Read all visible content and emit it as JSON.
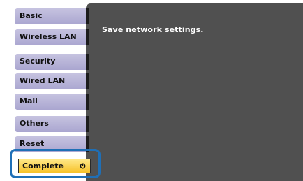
{
  "menu": {
    "items": [
      {
        "label": "Basic"
      },
      {
        "label": "Wireless LAN"
      },
      {
        "label": "Security"
      },
      {
        "label": "Wired LAN"
      },
      {
        "label": "Mail"
      },
      {
        "label": "Others"
      },
      {
        "label": "Reset"
      }
    ],
    "selected": {
      "label": "Complete",
      "icon": "enter-icon"
    }
  },
  "panel": {
    "message": "Save network settings."
  },
  "colors": {
    "tab": "#b5b1d8",
    "selected_tab": "#f9cd3c",
    "panel": "#505050",
    "highlight": "#1f6fb6"
  }
}
